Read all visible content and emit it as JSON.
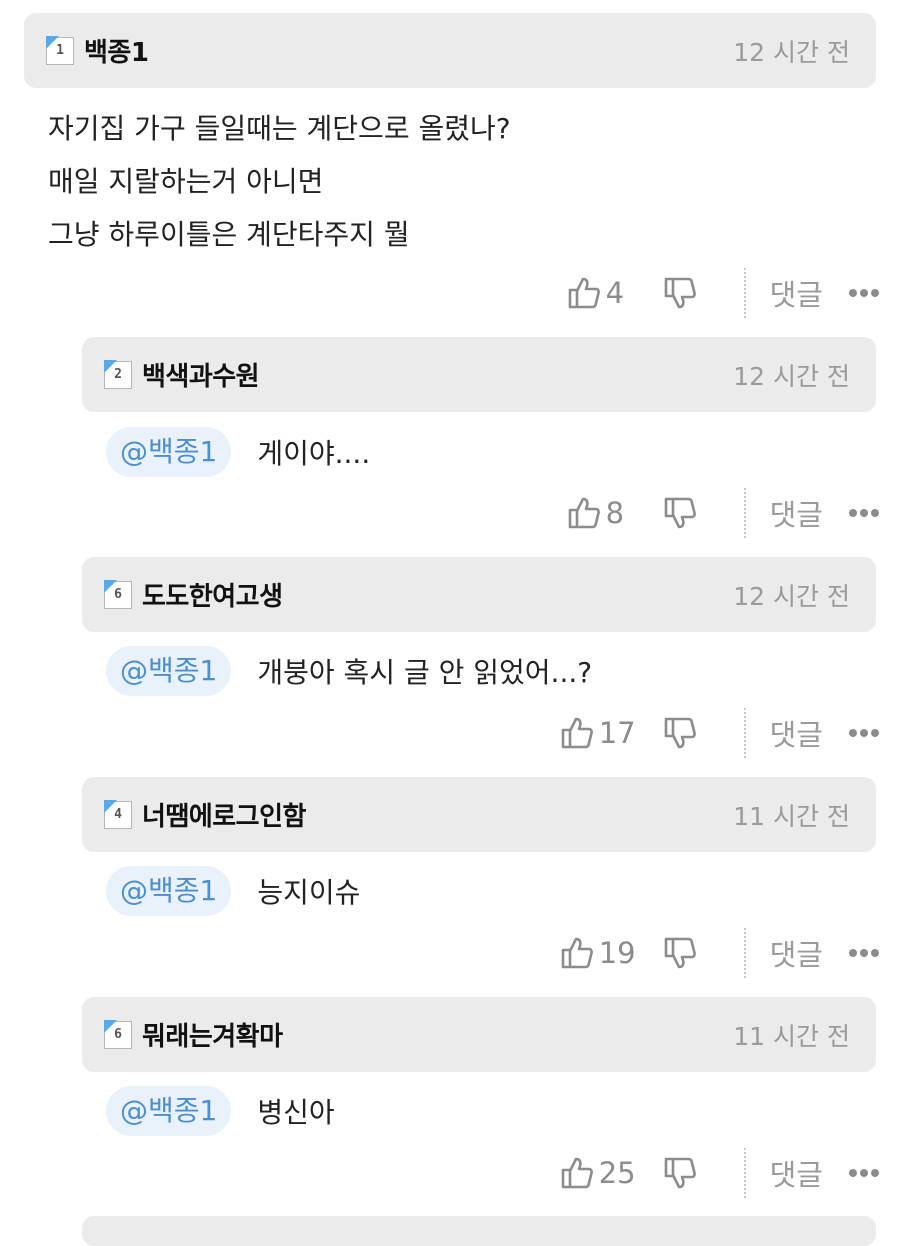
{
  "top_comment": {
    "user": "백종1",
    "level": "1",
    "time": "12 시간 전",
    "lines": [
      "자기집 가구 들일때는 계단으로 올렸나?",
      "매일 지랄하는거 아니면",
      "그냥 하루이틀은 계단타주지 뭘"
    ],
    "likes": "4"
  },
  "replies": [
    {
      "user": "백색과수원",
      "level": "2",
      "time": "12 시간 전",
      "mention": "@백종1",
      "text": "게이야....",
      "likes": "8"
    },
    {
      "user": "도도한여고생",
      "level": "6",
      "time": "12 시간 전",
      "mention": "@백종1",
      "text": "개붕아 혹시 글 안 읽었어...?",
      "likes": "17"
    },
    {
      "user": "너땜에로그인함",
      "level": "4",
      "time": "11 시간 전",
      "mention": "@백종1",
      "text": "능지이슈",
      "likes": "19"
    },
    {
      "user": "뭐래는겨확마",
      "level": "6",
      "time": "11 시간 전",
      "mention": "@백종1",
      "text": "병신아",
      "likes": "25"
    }
  ],
  "labels": {
    "reply": "댓글"
  },
  "icons": {
    "like": "thumbs-up-icon",
    "dislike": "thumbs-down-icon",
    "more": "more-dots-icon",
    "level": "level-badge-icon"
  },
  "colors": {
    "mention_bg": "#e9f2fb",
    "mention_text": "#4d8fce",
    "header_bg": "#ebebeb",
    "badge_accent": "#5aa9e6"
  }
}
